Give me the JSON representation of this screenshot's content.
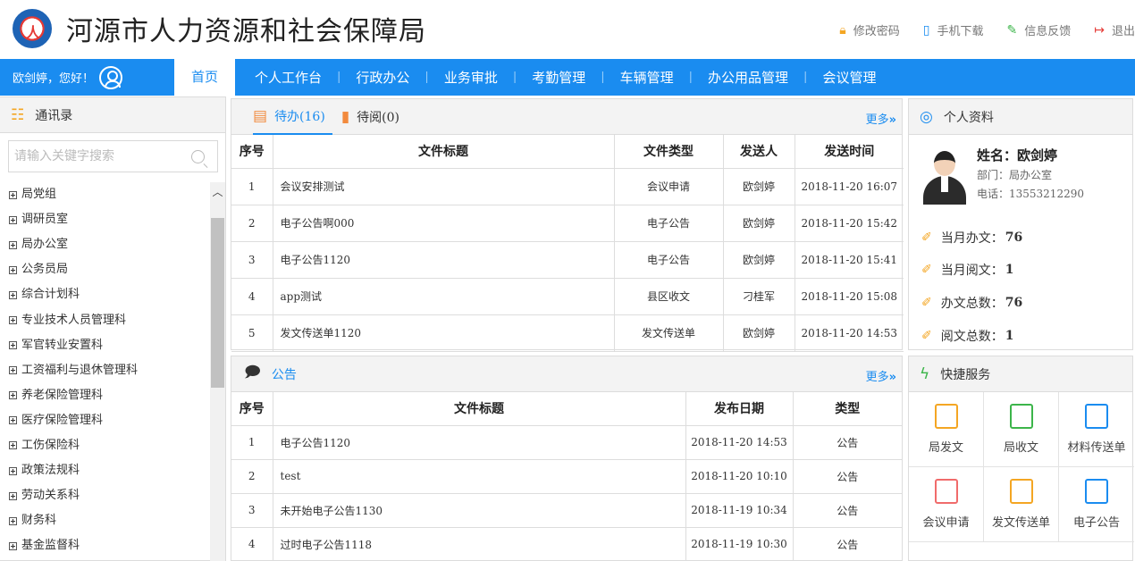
{
  "header": {
    "title": "河源市人力资源和社会保障局",
    "links": [
      {
        "label": "修改密码",
        "icon": "lock-icon",
        "color": "#f4a623"
      },
      {
        "label": "手机下载",
        "icon": "phone-icon",
        "color": "#1a8cf0"
      },
      {
        "label": "信息反馈",
        "icon": "edit-icon",
        "color": "#3cb54a"
      },
      {
        "label": "退出",
        "icon": "logout-icon",
        "color": "#e53935"
      }
    ]
  },
  "nav": {
    "greeting": "欧剑婷，您好！",
    "items": [
      "首页",
      "个人工作台",
      "行政办公",
      "业务审批",
      "考勤管理",
      "车辆管理",
      "办公用品管理",
      "会议管理"
    ]
  },
  "contacts": {
    "title": "通讯录",
    "search_placeholder": "请输入关键字搜索",
    "items": [
      "局党组",
      "调研员室",
      "局办公室",
      "公务员局",
      "综合计划科",
      "专业技术人员管理科",
      "军官转业安置科",
      "工资福利与退休管理科",
      "养老保险管理科",
      "医疗保险管理科",
      "工伤保险科",
      "政策法规科",
      "劳动关系科",
      "财务科",
      "基金监督科"
    ]
  },
  "todo": {
    "tab_pending": "待办(16)",
    "tab_read": "待阅(0)",
    "more": "更多",
    "columns": [
      "序号",
      "文件标题",
      "文件类型",
      "发送人",
      "发送时间"
    ],
    "rows": [
      {
        "no": "1",
        "title": "会议安排测试",
        "type": "会议申请",
        "sender": "欧剑婷",
        "time": "2018-11-20 16:07"
      },
      {
        "no": "2",
        "title": "电子公告啊000",
        "type": "电子公告",
        "sender": "欧剑婷",
        "time": "2018-11-20 15:42"
      },
      {
        "no": "3",
        "title": "电子公告1120",
        "type": "电子公告",
        "sender": "欧剑婷",
        "time": "2018-11-20 15:41"
      },
      {
        "no": "4",
        "title": "app测试",
        "type": "县区收文",
        "sender": "刁桂军",
        "time": "2018-11-20 15:08"
      },
      {
        "no": "5",
        "title": "发文传送单1120",
        "type": "发文传送单",
        "sender": "欧剑婷",
        "time": "2018-11-20 14:53"
      }
    ]
  },
  "notice": {
    "title": "公告",
    "more": "更多",
    "columns": [
      "序号",
      "文件标题",
      "发布日期",
      "类型"
    ],
    "rows": [
      {
        "no": "1",
        "title": "电子公告1120",
        "date": "2018-11-20 14:53",
        "type": "公告"
      },
      {
        "no": "2",
        "title": "test",
        "date": "2018-11-20 10:10",
        "type": "公告"
      },
      {
        "no": "3",
        "title": "未开始电子公告1130",
        "date": "2018-11-19 10:34",
        "type": "公告"
      },
      {
        "no": "4",
        "title": "过时电子公告1118",
        "date": "2018-11-19 10:30",
        "type": "公告"
      }
    ]
  },
  "profile": {
    "title": "个人资料",
    "name": "姓名：欧剑婷",
    "dept": "部门：局办公室",
    "phone": "电话：13553212290",
    "stats": [
      {
        "label": "当月办文：",
        "value": "76"
      },
      {
        "label": "当月阅文：",
        "value": "1"
      },
      {
        "label": "办文总数：",
        "value": "76"
      },
      {
        "label": "阅文总数：",
        "value": "1"
      }
    ]
  },
  "quick": {
    "title": "快捷服务",
    "items": [
      {
        "label": "局发文",
        "color": "#f4a623"
      },
      {
        "label": "局收文",
        "color": "#3cb54a"
      },
      {
        "label": "材料传送单",
        "color": "#1a8cf0"
      },
      {
        "label": "会议申请",
        "color": "#f06b6b"
      },
      {
        "label": "发文传送单",
        "color": "#f4a623"
      },
      {
        "label": "电子公告",
        "color": "#1a8cf0"
      }
    ]
  }
}
